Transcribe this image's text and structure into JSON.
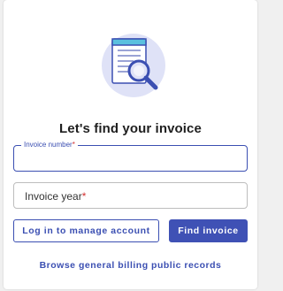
{
  "hero": {
    "icon": "invoice-search-icon"
  },
  "title": "Let's find your invoice",
  "invoice_number": {
    "label": "Invoice number",
    "required_mark": "*",
    "value": ""
  },
  "invoice_year": {
    "placeholder": "Invoice year",
    "required_mark": "*",
    "value": ""
  },
  "buttons": {
    "login_label": "Log in to manage account",
    "find_label": "Find invoice"
  },
  "link": {
    "browse_label": "Browse general billing public records"
  },
  "colors": {
    "accent": "#3f51b5",
    "required": "#d32f2f",
    "text": "#1f1f1f"
  }
}
